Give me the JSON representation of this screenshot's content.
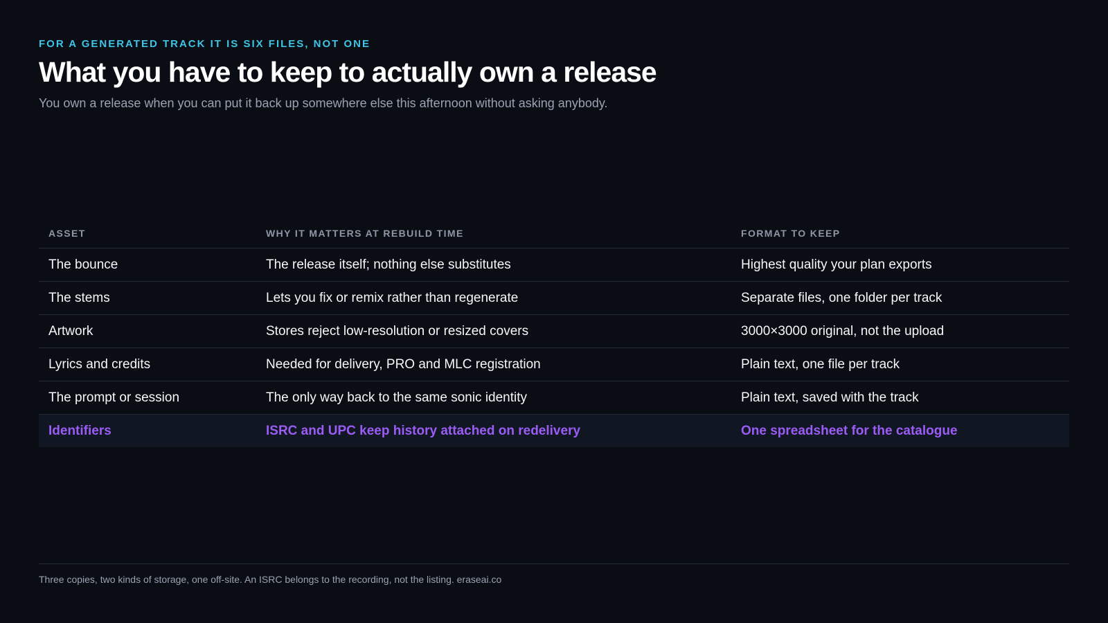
{
  "header": {
    "eyebrow": "FOR A GENERATED TRACK IT IS SIX FILES, NOT ONE",
    "title": "What you have to keep to actually own a release",
    "subtitle": "You own a release when you can put it back up somewhere else this afternoon without asking anybody."
  },
  "table": {
    "columns": [
      "ASSET",
      "WHY IT MATTERS AT REBUILD TIME",
      "FORMAT TO KEEP"
    ],
    "rows": [
      [
        "The bounce",
        "The release itself; nothing else substitutes",
        "Highest quality your plan exports"
      ],
      [
        "The stems",
        "Lets you fix or remix rather than regenerate",
        "Separate files, one folder per track"
      ],
      [
        "Artwork",
        "Stores reject low-resolution or resized covers",
        "3000×3000 original, not the upload"
      ],
      [
        "Lyrics and credits",
        "Needed for delivery, PRO and MLC registration",
        "Plain text, one file per track"
      ],
      [
        "The prompt or session",
        "The only way back to the same sonic identity",
        "Plain text, saved with the track"
      ],
      [
        "Identifiers",
        "ISRC and UPC keep history attached on redelivery",
        "One spreadsheet for the catalogue"
      ]
    ],
    "highlighted_row": 5
  },
  "footer": {
    "note": "Three copies, two kinds of storage, one off-site. An ISRC belongs to the recording, not the listing. eraseai.co"
  },
  "colors": {
    "background": "#0a0d14",
    "eyebrow": "#3fc4e6",
    "highlight_text": "#9b5cf6",
    "highlight_row_bg": "#111722",
    "muted_text": "#9aa3b2",
    "rule": "#232a36"
  }
}
